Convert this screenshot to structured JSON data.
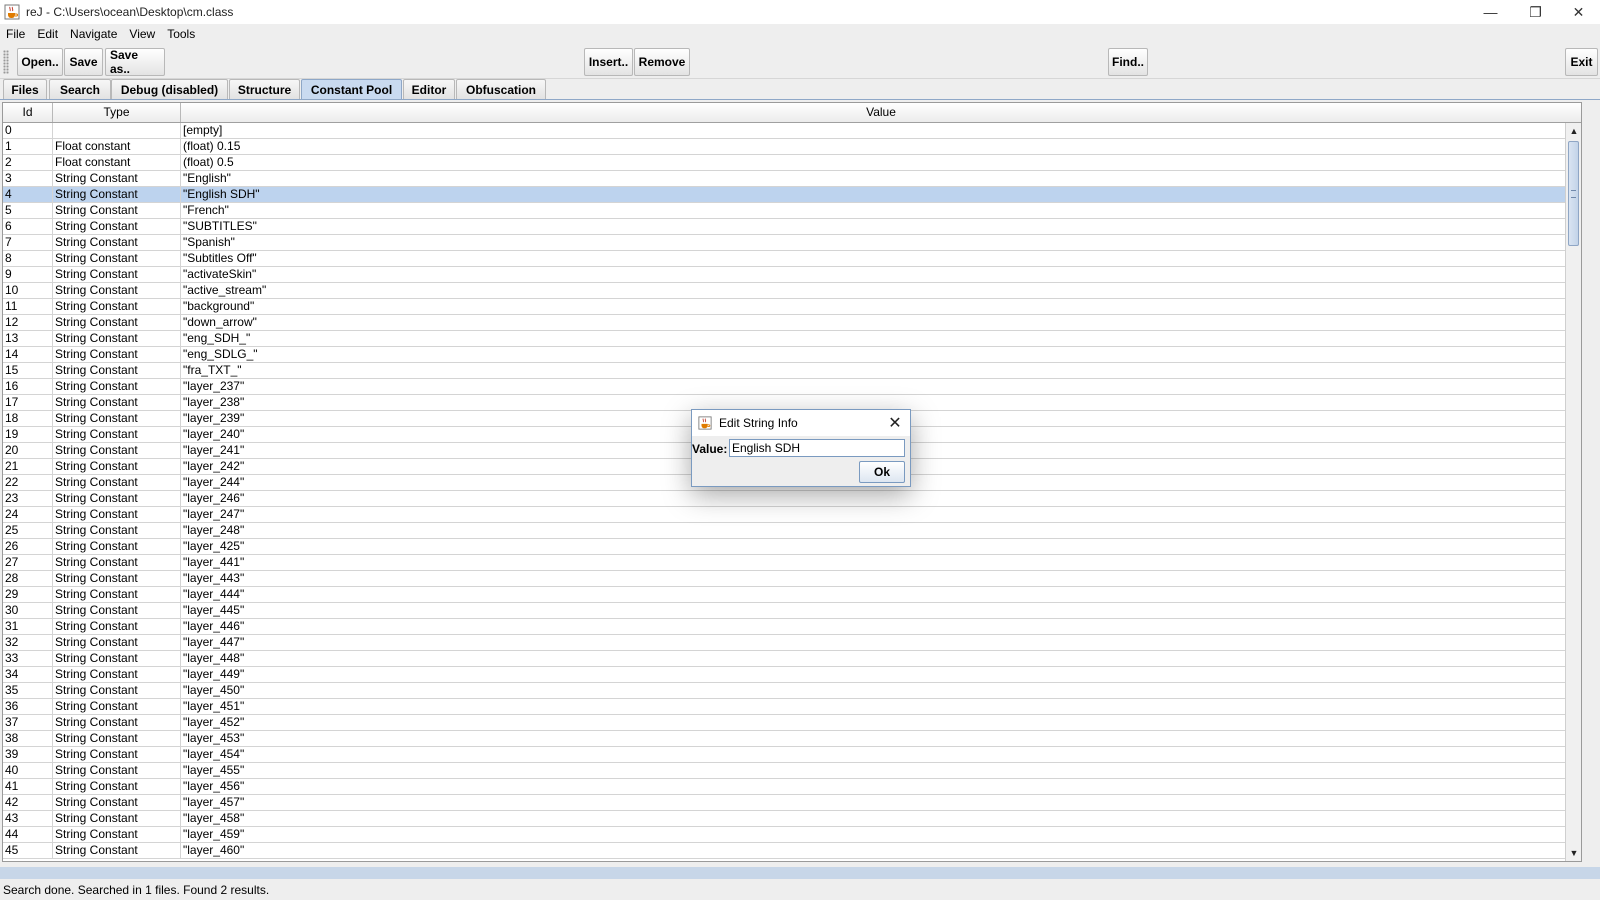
{
  "window": {
    "title": "reJ - C:\\Users\\ocean\\Desktop\\cm.class",
    "app_icon": "java-cup-icon",
    "controls": {
      "minimize": "—",
      "restore": "❐",
      "close": "✕"
    }
  },
  "menubar": [
    "File",
    "Edit",
    "Navigate",
    "View",
    "Tools"
  ],
  "toolbar": {
    "open": "Open..",
    "save": "Save",
    "save_as": "Save as..",
    "insert": "Insert..",
    "remove": "Remove",
    "find": "Find..",
    "exit": "Exit"
  },
  "tabs": [
    "Files",
    "Search",
    "Debug (disabled)",
    "Structure",
    "Constant Pool",
    "Editor",
    "Obfuscation"
  ],
  "active_tab": "Constant Pool",
  "table": {
    "columns": [
      "Id",
      "Type",
      "Value"
    ],
    "selected_id": "4",
    "rows": [
      [
        "0",
        "",
        "[empty]"
      ],
      [
        "1",
        "Float constant",
        "(float) 0.15"
      ],
      [
        "2",
        "Float constant",
        "(float) 0.5"
      ],
      [
        "3",
        "String Constant",
        "\"English\""
      ],
      [
        "4",
        "String Constant",
        "\"English SDH\""
      ],
      [
        "5",
        "String Constant",
        "\"French\""
      ],
      [
        "6",
        "String Constant",
        "\"SUBTITLES\""
      ],
      [
        "7",
        "String Constant",
        "\"Spanish\""
      ],
      [
        "8",
        "String Constant",
        "\"Subtitles Off\""
      ],
      [
        "9",
        "String Constant",
        "\"activateSkin\""
      ],
      [
        "10",
        "String Constant",
        "\"active_stream\""
      ],
      [
        "11",
        "String Constant",
        "\"background\""
      ],
      [
        "12",
        "String Constant",
        "\"down_arrow\""
      ],
      [
        "13",
        "String Constant",
        "\"eng_SDH_\""
      ],
      [
        "14",
        "String Constant",
        "\"eng_SDLG_\""
      ],
      [
        "15",
        "String Constant",
        "\"fra_TXT_\""
      ],
      [
        "16",
        "String Constant",
        "\"layer_237\""
      ],
      [
        "17",
        "String Constant",
        "\"layer_238\""
      ],
      [
        "18",
        "String Constant",
        "\"layer_239\""
      ],
      [
        "19",
        "String Constant",
        "\"layer_240\""
      ],
      [
        "20",
        "String Constant",
        "\"layer_241\""
      ],
      [
        "21",
        "String Constant",
        "\"layer_242\""
      ],
      [
        "22",
        "String Constant",
        "\"layer_244\""
      ],
      [
        "23",
        "String Constant",
        "\"layer_246\""
      ],
      [
        "24",
        "String Constant",
        "\"layer_247\""
      ],
      [
        "25",
        "String Constant",
        "\"layer_248\""
      ],
      [
        "26",
        "String Constant",
        "\"layer_425\""
      ],
      [
        "27",
        "String Constant",
        "\"layer_441\""
      ],
      [
        "28",
        "String Constant",
        "\"layer_443\""
      ],
      [
        "29",
        "String Constant",
        "\"layer_444\""
      ],
      [
        "30",
        "String Constant",
        "\"layer_445\""
      ],
      [
        "31",
        "String Constant",
        "\"layer_446\""
      ],
      [
        "32",
        "String Constant",
        "\"layer_447\""
      ],
      [
        "33",
        "String Constant",
        "\"layer_448\""
      ],
      [
        "34",
        "String Constant",
        "\"layer_449\""
      ],
      [
        "35",
        "String Constant",
        "\"layer_450\""
      ],
      [
        "36",
        "String Constant",
        "\"layer_451\""
      ],
      [
        "37",
        "String Constant",
        "\"layer_452\""
      ],
      [
        "38",
        "String Constant",
        "\"layer_453\""
      ],
      [
        "39",
        "String Constant",
        "\"layer_454\""
      ],
      [
        "40",
        "String Constant",
        "\"layer_455\""
      ],
      [
        "41",
        "String Constant",
        "\"layer_456\""
      ],
      [
        "42",
        "String Constant",
        "\"layer_457\""
      ],
      [
        "43",
        "String Constant",
        "\"layer_458\""
      ],
      [
        "44",
        "String Constant",
        "\"layer_459\""
      ],
      [
        "45",
        "String Constant",
        "\"layer_460\""
      ]
    ]
  },
  "scrollbar": {
    "up_arrow": "▲",
    "down_arrow": "▼"
  },
  "status": "Search done. Searched in 1 files. Found 2 results.",
  "dialog": {
    "title": "Edit String Info",
    "close_glyph": "✕",
    "value_label": "Value:",
    "value": "English SDH",
    "ok_label": "Ok"
  },
  "colors": {
    "selection": "#bdd3ee",
    "active_tab": "#c9daf0",
    "accent_border": "#7a9ac0"
  }
}
